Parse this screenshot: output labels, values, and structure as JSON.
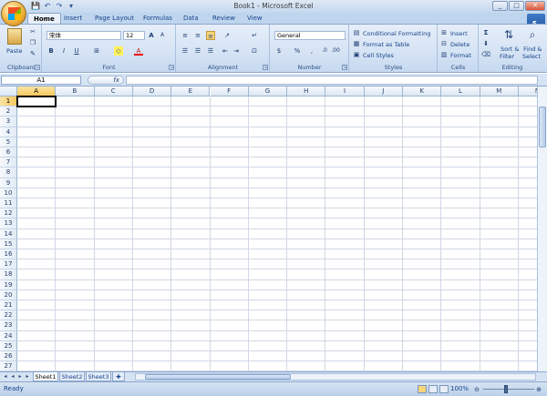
{
  "window": {
    "title": "Book1 - Microsoft Excel",
    "controls": [
      "_",
      "□",
      "✕"
    ]
  },
  "qat": [
    "💾",
    "↶",
    "↷",
    "▾"
  ],
  "tabs": [
    "Home",
    "Insert",
    "Page Layout",
    "Formulas",
    "Data",
    "Review",
    "View"
  ],
  "active_tab": "Home",
  "ribbon": {
    "clipboard": {
      "label": "Clipboard",
      "paste": "Paste"
    },
    "font": {
      "label": "Font",
      "name": "宋体",
      "size": "12",
      "bold": "B",
      "italic": "I",
      "underline": "U",
      "grow": "A",
      "shrink": "A"
    },
    "alignment": {
      "label": "Alignment"
    },
    "number": {
      "label": "Number",
      "format": "General",
      "currency": "$",
      "percent": "%",
      "comma": ","
    },
    "styles": {
      "label": "Styles",
      "conditional": "Conditional Formatting",
      "format_table": "Format as Table",
      "cell_styles": "Cell Styles"
    },
    "cells": {
      "label": "Cells",
      "insert": "Insert",
      "delete": "Delete",
      "format": "Format"
    },
    "editing": {
      "label": "Editing",
      "sum": "Σ",
      "sort": "Sort &",
      "sort2": "Filter",
      "find": "Find &",
      "find2": "Select"
    }
  },
  "formula_bar": {
    "name_box": "A1",
    "fx": "fx",
    "value": ""
  },
  "columns": [
    "A",
    "B",
    "C",
    "D",
    "E",
    "F",
    "G",
    "H",
    "I",
    "J",
    "K",
    "L",
    "M",
    "N"
  ],
  "rows": [
    "1",
    "2",
    "3",
    "4",
    "5",
    "6",
    "7",
    "8",
    "9",
    "10",
    "11",
    "12",
    "13",
    "14",
    "15",
    "16",
    "17",
    "18",
    "19",
    "20",
    "21",
    "22",
    "23",
    "24",
    "25",
    "26",
    "27"
  ],
  "sheets": [
    "Sheet1",
    "Sheet2",
    "Sheet3"
  ],
  "active_sheet": "Sheet1",
  "status": {
    "text": "Ready",
    "zoom": "100%"
  },
  "colors": {
    "accent": "#15428b",
    "ribbon": "#d5e3f4",
    "selection": "#f8c95f"
  }
}
